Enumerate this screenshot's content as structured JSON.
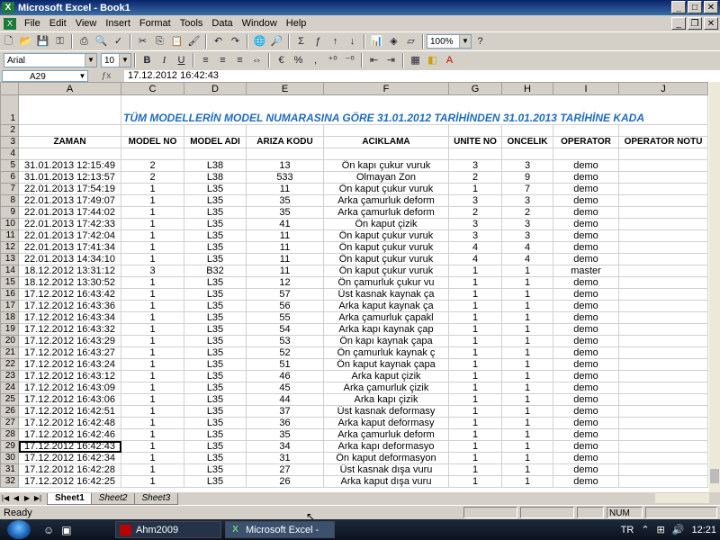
{
  "window": {
    "title": "Microsoft Excel - Book1"
  },
  "menu": [
    "File",
    "Edit",
    "View",
    "Insert",
    "Format",
    "Tools",
    "Data",
    "Window",
    "Help"
  ],
  "toolbar": {
    "zoom": "100%",
    "font": "Arial",
    "size": "10",
    "bold": "B",
    "italic": "I",
    "underline": "U",
    "percent": "%",
    "comma": ","
  },
  "formula": {
    "namebox": "A29",
    "value": "17.12.2012 16:42:43"
  },
  "columns": [
    "A",
    "C",
    "D",
    "E",
    "F",
    "G",
    "H",
    "I",
    "J"
  ],
  "sheet_title": "TÜM MODELLERİN     MODEL NUMARASINA GÖRE 31.01.2012   TARİHİNDEN   31.01.2013   TARİHİNE KADA",
  "headers": [
    "ZAMAN",
    "MODEL NO",
    "MODEL  ADI",
    "ARIZA  KODU",
    "ACIKLAMA",
    "ÜNİTE  NO",
    "ONCELIK",
    "OPERATOR",
    "OPERATOR NOTU"
  ],
  "rows": [
    {
      "n": "5",
      "zaman": "31.01.2013 12:15:49",
      "model_no": "2",
      "model_adi": "L38",
      "kod": "13",
      "aciklama": "Ön kapı çukur vuruk",
      "unite": "3",
      "oncelik": "3",
      "operator": "demo"
    },
    {
      "n": "6",
      "zaman": "31.01.2013 12:13:57",
      "model_no": "2",
      "model_adi": "L38",
      "kod": "533",
      "aciklama": "Olmayan Zon",
      "unite": "2",
      "oncelik": "9",
      "operator": "demo"
    },
    {
      "n": "7",
      "zaman": "22.01.2013 17:54:19",
      "model_no": "1",
      "model_adi": "L35",
      "kod": "11",
      "aciklama": "Ön kaput çukur vuruk",
      "unite": "1",
      "oncelik": "7",
      "operator": "demo"
    },
    {
      "n": "8",
      "zaman": "22.01.2013 17:49:07",
      "model_no": "1",
      "model_adi": "L35",
      "kod": "35",
      "aciklama": "Arka çamurluk deform",
      "unite": "3",
      "oncelik": "3",
      "operator": "demo"
    },
    {
      "n": "9",
      "zaman": "22.01.2013 17:44:02",
      "model_no": "1",
      "model_adi": "L35",
      "kod": "35",
      "aciklama": "Arka çamurluk deform",
      "unite": "2",
      "oncelik": "2",
      "operator": "demo"
    },
    {
      "n": "10",
      "zaman": "22.01.2013 17:42:33",
      "model_no": "1",
      "model_adi": "L35",
      "kod": "41",
      "aciklama": "Ön kaput çizik",
      "unite": "3",
      "oncelik": "3",
      "operator": "demo"
    },
    {
      "n": "11",
      "zaman": "22.01.2013 17:42:04",
      "model_no": "1",
      "model_adi": "L35",
      "kod": "11",
      "aciklama": "Ön kaput çukur vuruk",
      "unite": "3",
      "oncelik": "3",
      "operator": "demo"
    },
    {
      "n": "12",
      "zaman": "22.01.2013 17:41:34",
      "model_no": "1",
      "model_adi": "L35",
      "kod": "11",
      "aciklama": "Ön kaput çukur vuruk",
      "unite": "4",
      "oncelik": "4",
      "operator": "demo"
    },
    {
      "n": "13",
      "zaman": "22.01.2013 14:34:10",
      "model_no": "1",
      "model_adi": "L35",
      "kod": "11",
      "aciklama": "Ön kaput çukur vuruk",
      "unite": "4",
      "oncelik": "4",
      "operator": "demo"
    },
    {
      "n": "14",
      "zaman": "18.12.2012 13:31:12",
      "model_no": "3",
      "model_adi": "B32",
      "kod": "11",
      "aciklama": "Ön kaput çukur vuruk",
      "unite": "1",
      "oncelik": "1",
      "operator": "master"
    },
    {
      "n": "15",
      "zaman": "18.12.2012 13:30:52",
      "model_no": "1",
      "model_adi": "L35",
      "kod": "12",
      "aciklama": "Ön çamurluk çukur vu",
      "unite": "1",
      "oncelik": "1",
      "operator": "demo"
    },
    {
      "n": "16",
      "zaman": "17.12.2012 16:43:42",
      "model_no": "1",
      "model_adi": "L35",
      "kod": "57",
      "aciklama": "Üst kasnak kaynak ça",
      "unite": "1",
      "oncelik": "1",
      "operator": "demo"
    },
    {
      "n": "17",
      "zaman": "17.12.2012 16:43:36",
      "model_no": "1",
      "model_adi": "L35",
      "kod": "56",
      "aciklama": "Arka kaput kaynak ça",
      "unite": "1",
      "oncelik": "1",
      "operator": "demo"
    },
    {
      "n": "18",
      "zaman": "17.12.2012 16:43:34",
      "model_no": "1",
      "model_adi": "L35",
      "kod": "55",
      "aciklama": "Arka çamurluk çapakl",
      "unite": "1",
      "oncelik": "1",
      "operator": "demo"
    },
    {
      "n": "19",
      "zaman": "17.12.2012 16:43:32",
      "model_no": "1",
      "model_adi": "L35",
      "kod": "54",
      "aciklama": "Arka kapı kaynak çap",
      "unite": "1",
      "oncelik": "1",
      "operator": "demo"
    },
    {
      "n": "20",
      "zaman": "17.12.2012 16:43:29",
      "model_no": "1",
      "model_adi": "L35",
      "kod": "53",
      "aciklama": "Ön kapı kaynak  çapa",
      "unite": "1",
      "oncelik": "1",
      "operator": "demo"
    },
    {
      "n": "21",
      "zaman": "17.12.2012 16:43:27",
      "model_no": "1",
      "model_adi": "L35",
      "kod": "52",
      "aciklama": "Ön çamurluk kaynak ç",
      "unite": "1",
      "oncelik": "1",
      "operator": "demo"
    },
    {
      "n": "22",
      "zaman": "17.12.2012 16:43:24",
      "model_no": "1",
      "model_adi": "L35",
      "kod": "51",
      "aciklama": "Ön kaput kaynak çapa",
      "unite": "1",
      "oncelik": "1",
      "operator": "demo"
    },
    {
      "n": "23",
      "zaman": "17.12.2012 16:43:12",
      "model_no": "1",
      "model_adi": "L35",
      "kod": "46",
      "aciklama": "Arka kaput çizik",
      "unite": "1",
      "oncelik": "1",
      "operator": "demo"
    },
    {
      "n": "24",
      "zaman": "17.12.2012 16:43:09",
      "model_no": "1",
      "model_adi": "L35",
      "kod": "45",
      "aciklama": "Arka çamurluk çizik",
      "unite": "1",
      "oncelik": "1",
      "operator": "demo"
    },
    {
      "n": "25",
      "zaman": "17.12.2012 16:43:06",
      "model_no": "1",
      "model_adi": "L35",
      "kod": "44",
      "aciklama": "Arka kapı çizik",
      "unite": "1",
      "oncelik": "1",
      "operator": "demo"
    },
    {
      "n": "26",
      "zaman": "17.12.2012 16:42:51",
      "model_no": "1",
      "model_adi": "L35",
      "kod": "37",
      "aciklama": "Üst kasnak deformasy",
      "unite": "1",
      "oncelik": "1",
      "operator": "demo"
    },
    {
      "n": "27",
      "zaman": "17.12.2012 16:42:48",
      "model_no": "1",
      "model_adi": "L35",
      "kod": "36",
      "aciklama": "Arka kaput deformasy",
      "unite": "1",
      "oncelik": "1",
      "operator": "demo"
    },
    {
      "n": "28",
      "zaman": "17.12.2012 16:42:46",
      "model_no": "1",
      "model_adi": "L35",
      "kod": "35",
      "aciklama": "Arka çamurluk deform",
      "unite": "1",
      "oncelik": "1",
      "operator": "demo"
    },
    {
      "n": "29",
      "zaman": "17.12.2012 16:42:43",
      "model_no": "1",
      "model_adi": "L35",
      "kod": "34",
      "aciklama": "Arka kapı deformasyo",
      "unite": "1",
      "oncelik": "1",
      "operator": "demo"
    },
    {
      "n": "30",
      "zaman": "17.12.2012 16:42:34",
      "model_no": "1",
      "model_adi": "L35",
      "kod": "31",
      "aciklama": "Ön kaput deformasyon",
      "unite": "1",
      "oncelik": "1",
      "operator": "demo"
    },
    {
      "n": "31",
      "zaman": "17.12.2012 16:42:28",
      "model_no": "1",
      "model_adi": "L35",
      "kod": "27",
      "aciklama": "Üst kasnak dışa vuru",
      "unite": "1",
      "oncelik": "1",
      "operator": "demo"
    },
    {
      "n": "32",
      "zaman": "17.12.2012 16:42:25",
      "model_no": "1",
      "model_adi": "L35",
      "kod": "26",
      "aciklama": "Arka kaput dışa vuru",
      "unite": "1",
      "oncelik": "1",
      "operator": "demo"
    }
  ],
  "tabs": [
    "Sheet1",
    "Sheet2",
    "Sheet3"
  ],
  "status": {
    "left": "Ready",
    "num": "NUM"
  },
  "taskbar": {
    "items": [
      "Ahm2009",
      "Microsoft Excel - Bo..."
    ],
    "lang": "TR",
    "clock": "12:21"
  }
}
